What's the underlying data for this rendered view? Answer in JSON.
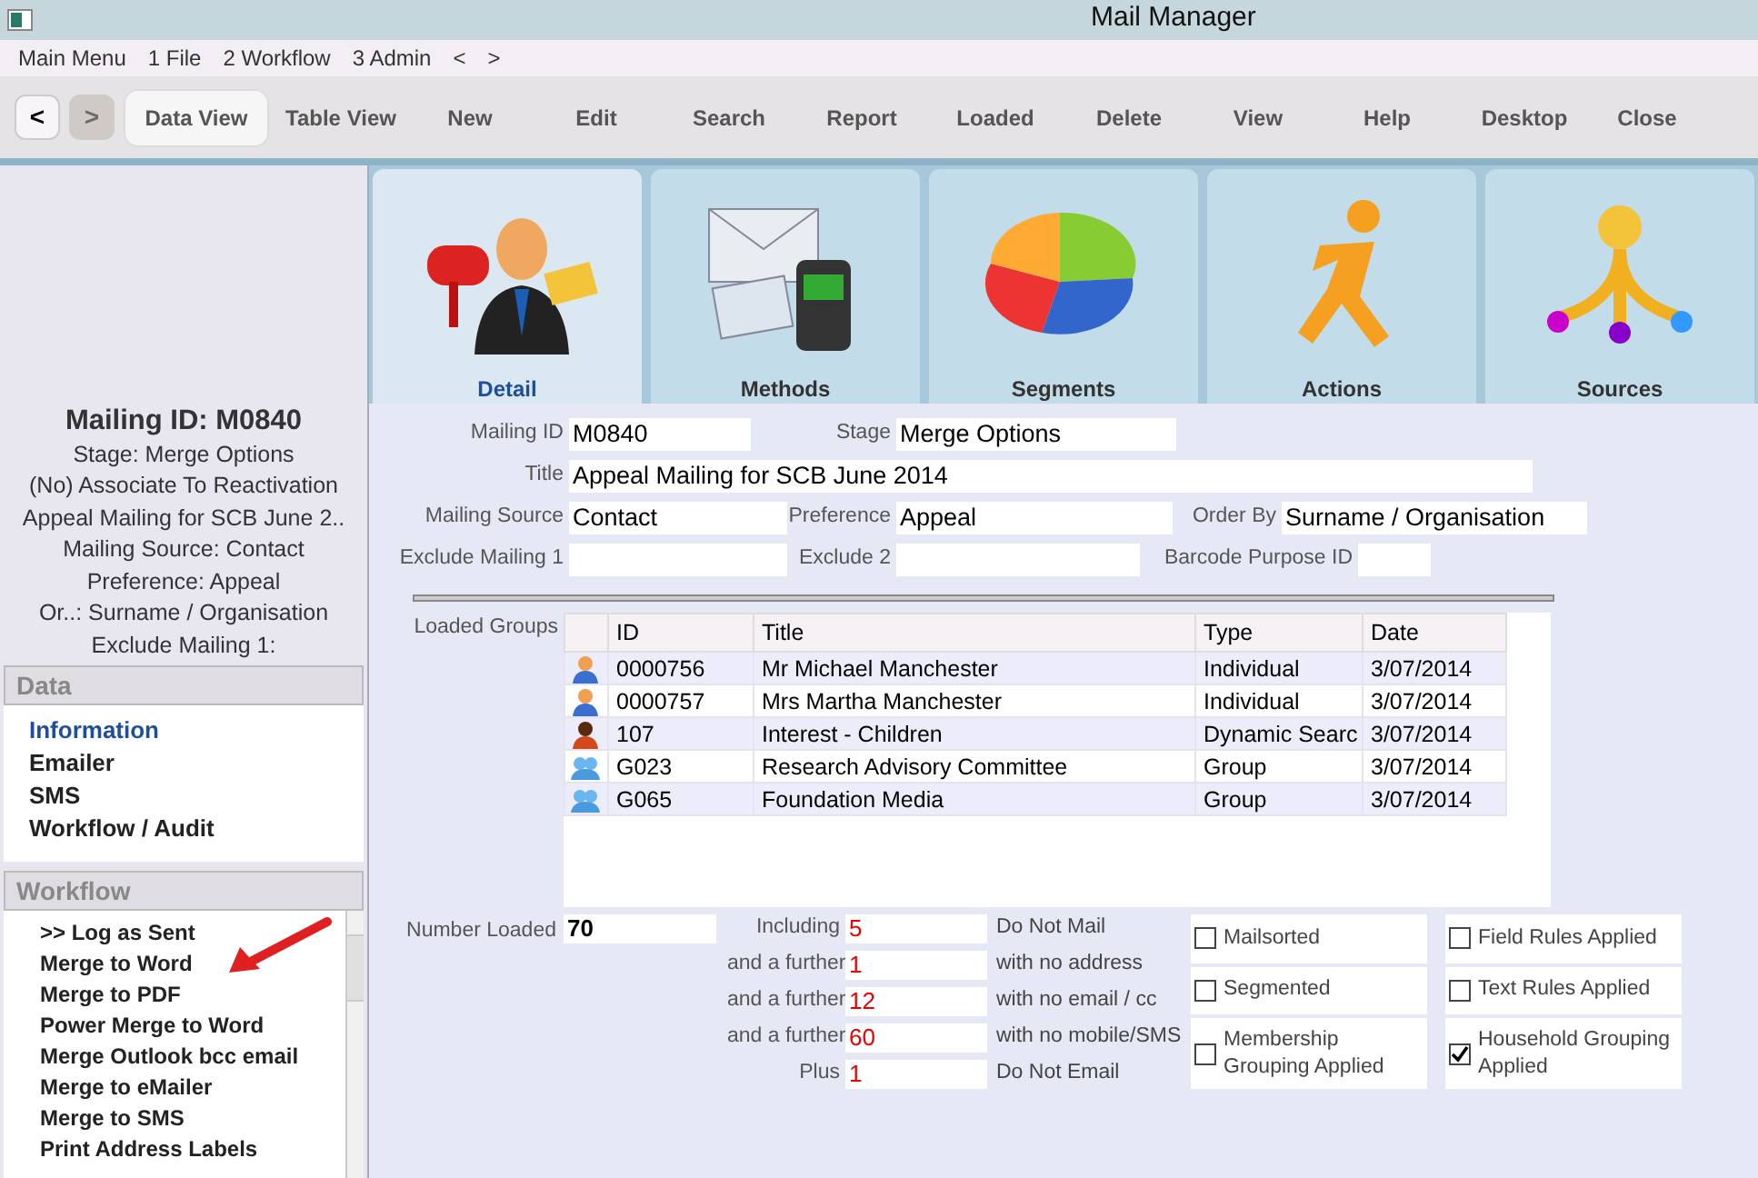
{
  "window": {
    "title": "Mail Manager"
  },
  "menu": [
    "Main Menu",
    "1 File",
    "2 Workflow",
    "3 Admin",
    "<",
    ">"
  ],
  "toolbar": {
    "nav": [
      {
        "label": "<",
        "disabled": false
      },
      {
        "label": ">",
        "disabled": true
      }
    ],
    "buttons": [
      {
        "label": "Data View",
        "selected": true
      },
      {
        "label": "Table View",
        "selected": false
      },
      {
        "label": "New",
        "selected": false
      },
      {
        "label": "Edit",
        "selected": false
      },
      {
        "label": "Search",
        "selected": false
      },
      {
        "label": "Report",
        "selected": false
      },
      {
        "label": "Loaded",
        "selected": false
      },
      {
        "label": "Delete",
        "selected": false
      },
      {
        "label": "View",
        "selected": false
      },
      {
        "label": "Help",
        "selected": false
      },
      {
        "label": "Desktop",
        "selected": false
      },
      {
        "label": "Close",
        "selected": false
      }
    ]
  },
  "sidebar": {
    "summary": {
      "heading": "Mailing ID: M0840",
      "lines": [
        "Stage: Merge Options",
        "(No) Associate To Reactivation",
        "Appeal Mailing for SCB June 2..",
        "Mailing Source: Contact",
        "Preference: Appeal",
        "Or..: Surname / Organisation",
        "Exclude Mailing 1:"
      ]
    },
    "data": {
      "title": "Data",
      "items": [
        {
          "label": "Information",
          "selected": true
        },
        {
          "label": "Emailer",
          "selected": false
        },
        {
          "label": "SMS",
          "selected": false
        },
        {
          "label": "Workflow / Audit",
          "selected": false
        }
      ]
    },
    "workflow": {
      "title": "Workflow",
      "items": [
        ">> Log as Sent",
        "Merge to Word",
        "Merge to PDF",
        "Power Merge to Word",
        "Merge Outlook bcc email",
        "Merge to eMailer",
        "Merge to SMS",
        "Print Address Labels"
      ]
    }
  },
  "tabs": [
    {
      "label": "Detail",
      "kind": "mailbox",
      "selected": true
    },
    {
      "label": "Methods",
      "kind": "envelopes",
      "selected": false
    },
    {
      "label": "Segments",
      "kind": "pie",
      "selected": false
    },
    {
      "label": "Actions",
      "kind": "runner",
      "selected": false
    },
    {
      "label": "Sources",
      "kind": "funnel",
      "selected": false
    }
  ],
  "form": {
    "rows": [
      [
        {
          "label": "Mailing ID",
          "value": "M0840"
        },
        {
          "label": "Stage",
          "value": "Merge Options"
        }
      ],
      [
        {
          "label": "Title",
          "value": "Appeal Mailing for SCB June 2014"
        }
      ],
      [
        {
          "label": "Mailing Source",
          "value": "Contact"
        },
        {
          "label": "Preference",
          "value": "Appeal"
        },
        {
          "label": "Order By",
          "value": "Surname / Organisation"
        }
      ],
      [
        {
          "label": "Exclude Mailing 1"
        },
        {
          "label": "Exclude 2"
        },
        {
          "label": "Barcode Purpose ID"
        }
      ]
    ]
  },
  "loaded_groups": {
    "label": "Loaded Groups",
    "columns": [
      "ID",
      "Title",
      "Type",
      "Date"
    ],
    "rows": [
      {
        "kind": "person",
        "id": "0000756",
        "title": "Mr Michael Manchester",
        "type": "Individual",
        "date": "3/07/2014"
      },
      {
        "kind": "person",
        "id": "0000757",
        "title": "Mrs Martha Manchester",
        "type": "Individual",
        "date": "3/07/2014"
      },
      {
        "kind": "search",
        "id": "107",
        "title": "Interest - Children",
        "type": "Dynamic Searc",
        "date": "3/07/2014"
      },
      {
        "kind": "group",
        "id": "G023",
        "title": "Research Advisory Committee",
        "type": "Group",
        "date": "3/07/2014"
      },
      {
        "kind": "group",
        "id": "G065",
        "title": "Foundation Media",
        "type": "Group",
        "date": "3/07/2014"
      }
    ]
  },
  "counts": {
    "number_loaded": {
      "label": "Number Loaded",
      "value": "70"
    },
    "rows": [
      {
        "label": "Including",
        "value": "5",
        "description": "Do Not Mail"
      },
      {
        "label": "and a further",
        "value": "1",
        "description": "with no address"
      },
      {
        "label": "and a further",
        "value": "12",
        "description": "with no email / cc"
      },
      {
        "label": "and a further",
        "value": "60",
        "description": "with no mobile/SMS"
      },
      {
        "label": "Plus",
        "value": "1",
        "description": "Do Not Email"
      }
    ]
  },
  "options": [
    {
      "label": "Mailsorted",
      "checked": false
    },
    {
      "label": "Field Rules Applied",
      "checked": false
    },
    {
      "label": "Segmented",
      "checked": false
    },
    {
      "label": "Text Rules Applied",
      "checked": false
    },
    {
      "label": "Membership Grouping Applied",
      "checked": false
    },
    {
      "label": "Household Grouping Applied",
      "checked": true
    }
  ]
}
